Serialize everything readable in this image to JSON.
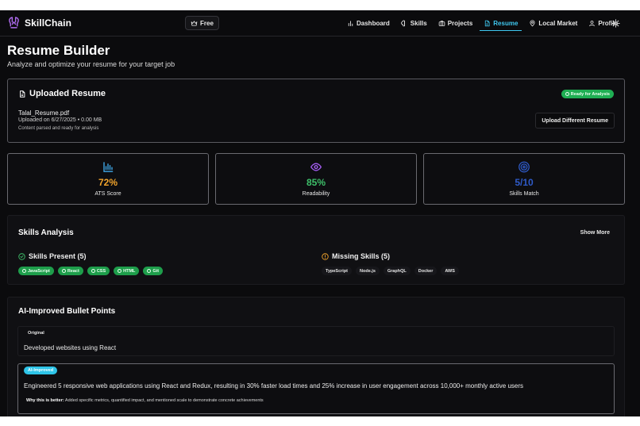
{
  "brand": {
    "name": "SkillChain",
    "logo_icon": "skillchain-logo-icon",
    "accent": "#b06cf0"
  },
  "nav": {
    "plan_label": "Free",
    "items": [
      {
        "label": "Dashboard",
        "icon": "bar-chart-icon"
      },
      {
        "label": "Skills",
        "icon": "brain-icon"
      },
      {
        "label": "Projects",
        "icon": "briefcase-icon"
      },
      {
        "label": "Resume",
        "icon": "file-icon",
        "active": true
      },
      {
        "label": "Local Market",
        "icon": "map-pin-icon"
      },
      {
        "label": "Profile",
        "icon": "user-icon"
      }
    ],
    "active_color": "#3fc8f0"
  },
  "header": {
    "title": "Resume Builder",
    "subtitle": "Analyze and optimize your resume for your target job"
  },
  "uploaded": {
    "title": "Uploaded Resume",
    "status_badge": "Ready for Analysis",
    "file_name": "Talal_Resume.pdf",
    "meta": "Uploaded on 6/27/2025 • 0.00 MB",
    "status_text": "Content parsed and ready for analysis",
    "upload_button": "Upload Different Resume"
  },
  "stats": [
    {
      "value": "72%",
      "label": "ATS Score",
      "color": "#f2a42c",
      "icon": "bar-chart-icon"
    },
    {
      "value": "85%",
      "label": "Readability",
      "color": "#3ec06a",
      "icon": "eye-icon"
    },
    {
      "value": "5/10",
      "label": "Skills Match",
      "color": "#2f5bc9",
      "icon": "target-icon"
    }
  ],
  "skills": {
    "title": "Skills Analysis",
    "show_more": "Show More",
    "present_title": "Skills Present (5)",
    "present": [
      "JavaScript",
      "React",
      "CSS",
      "HTML",
      "Git"
    ],
    "missing_title": "Missing Skills (5)",
    "missing": [
      "TypeScript",
      "Node.js",
      "GraphQL",
      "Docker",
      "AWS"
    ]
  },
  "ai": {
    "title": "AI-Improved Bullet Points",
    "original_tag": "Original",
    "original_text": "Developed websites using React",
    "improved_tag": "AI-Improved",
    "improved_text": "Engineered 5 responsive web applications using React and Redux, resulting in 30% faster load times and 25% increase in user engagement across 10,000+ monthly active users",
    "why_label": "Why this is better:",
    "why_text": "Added specific metrics, quantified impact, and mentioned scale to demonstrate concrete achievements"
  }
}
